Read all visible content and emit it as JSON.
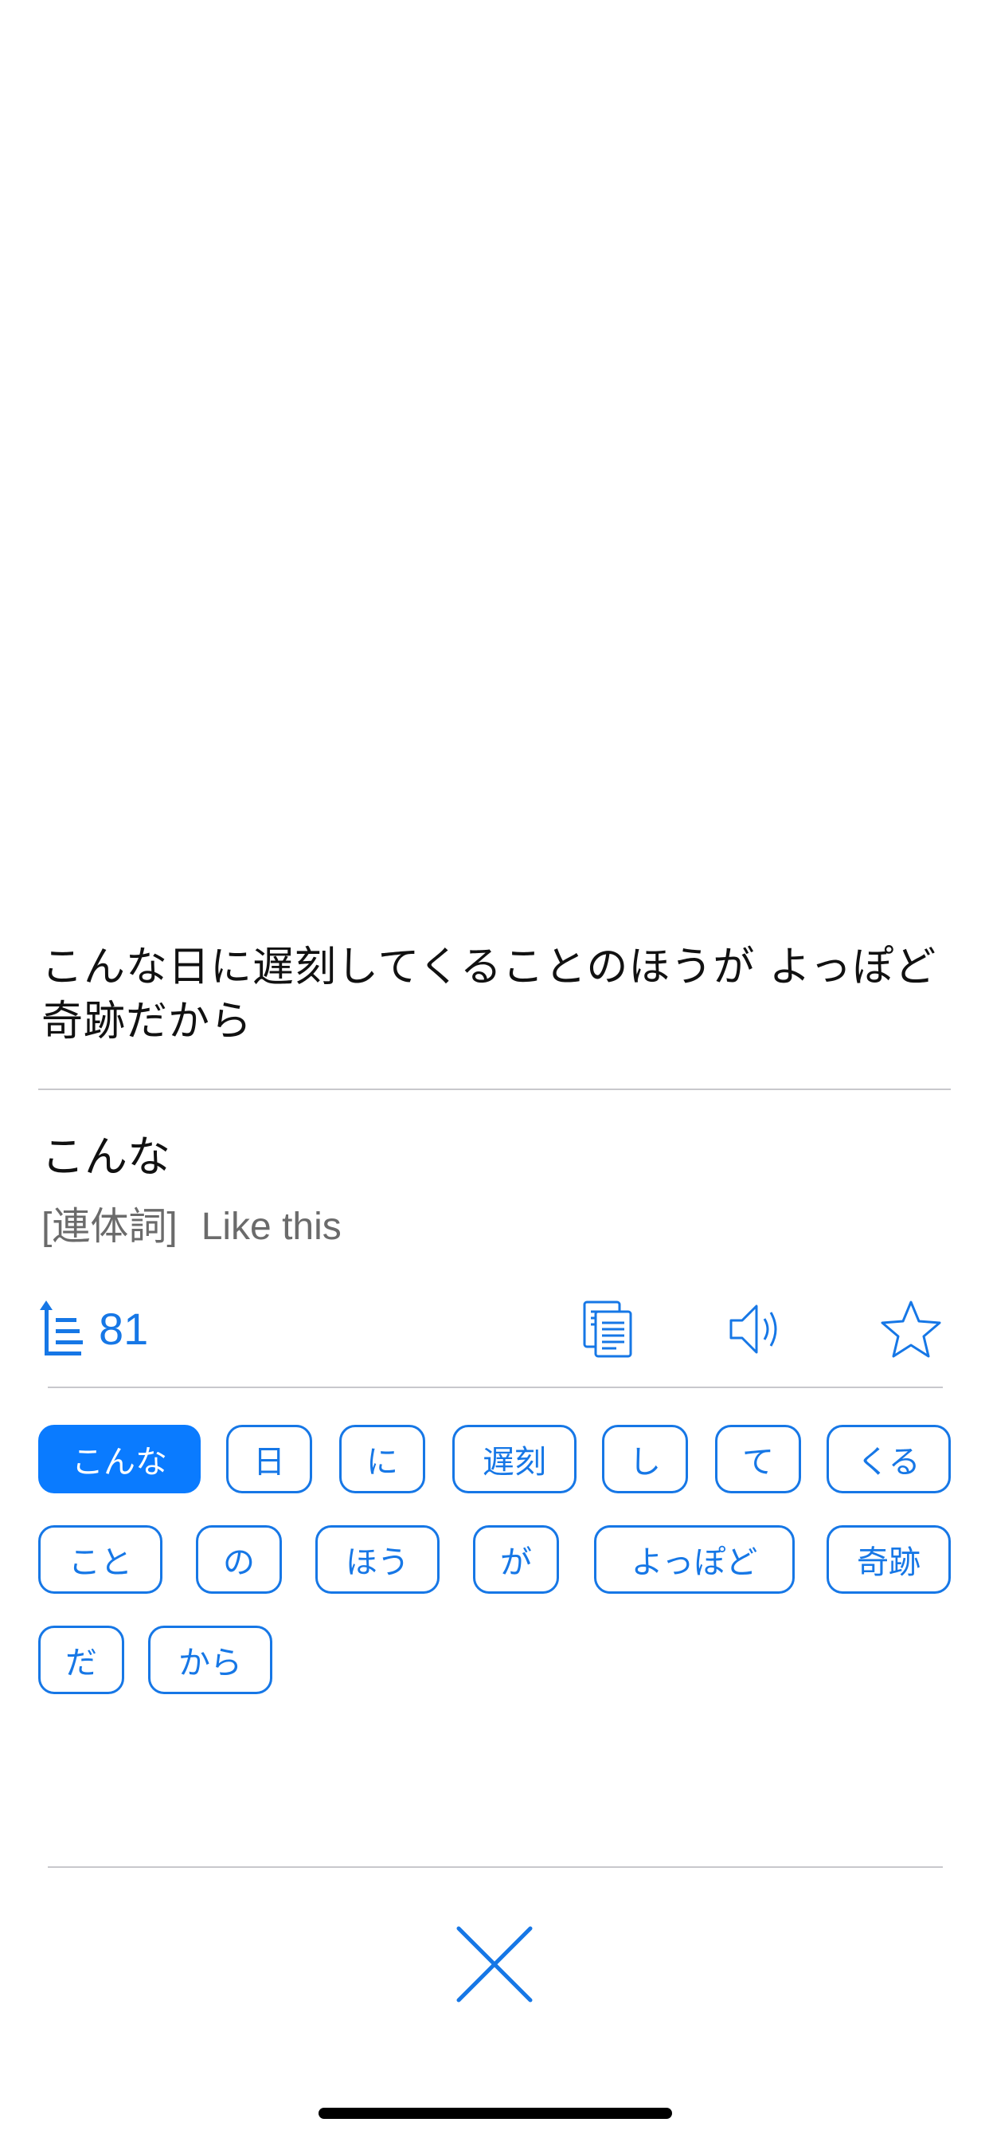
{
  "sentence": "こんな日に遅刻してくることのほうが よっぽど奇跡だから",
  "word": {
    "text": "こんな",
    "part_of_speech": "[連体詞]",
    "meaning": "Like this"
  },
  "toolbar": {
    "level_count": "81",
    "copy_icon": "copy-icon",
    "sound_icon": "speaker-icon",
    "star_icon": "star-outline-icon"
  },
  "tokens": [
    {
      "text": "こんな",
      "active": true
    },
    {
      "text": "日",
      "active": false
    },
    {
      "text": "に",
      "active": false
    },
    {
      "text": "遅刻",
      "active": false
    },
    {
      "text": "し",
      "active": false
    },
    {
      "text": "て",
      "active": false
    },
    {
      "text": "くる",
      "active": false
    },
    {
      "text": "こと",
      "active": false
    },
    {
      "text": "の",
      "active": false
    },
    {
      "text": "ほう",
      "active": false
    },
    {
      "text": "が",
      "active": false
    },
    {
      "text": "よっぽど",
      "active": false
    },
    {
      "text": "奇跡",
      "active": false
    },
    {
      "text": "だ",
      "active": false
    },
    {
      "text": "から",
      "active": false
    }
  ],
  "colors": {
    "accent": "#1677e6",
    "active_chip": "#0a7bff",
    "divider": "#c8c8cc",
    "muted_text": "#6b6b6b"
  }
}
